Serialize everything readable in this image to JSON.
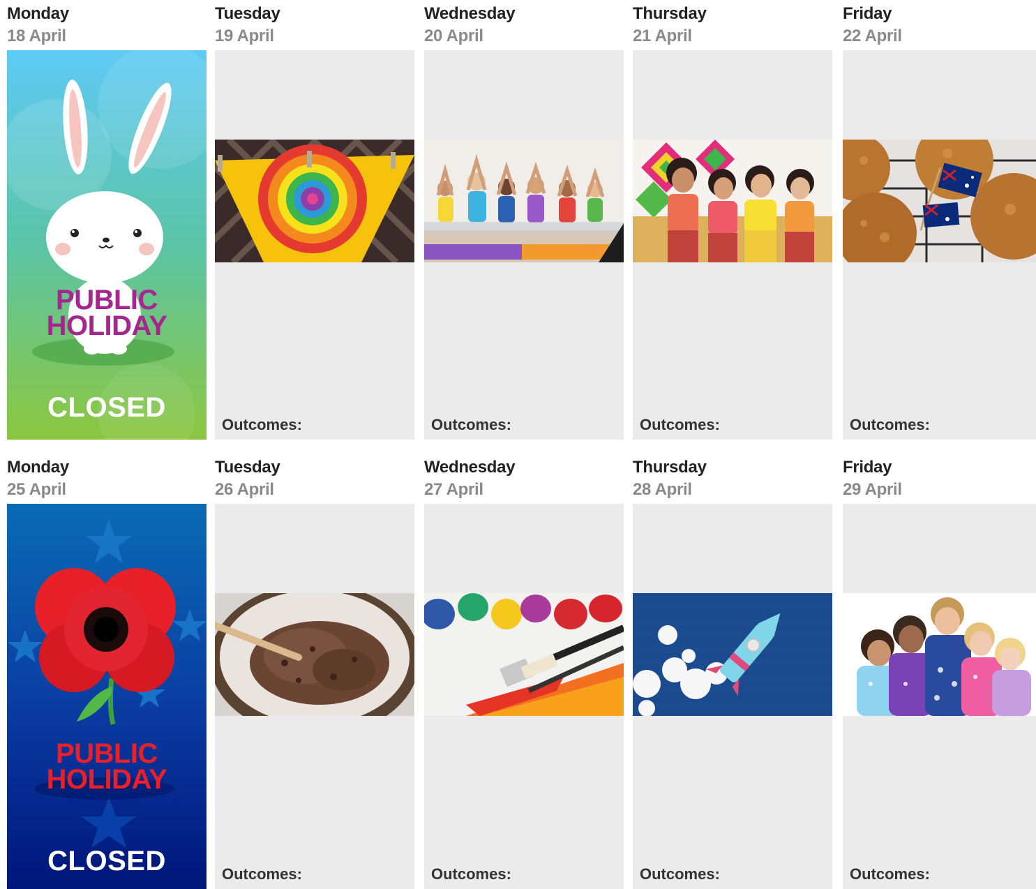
{
  "weeks": [
    {
      "days": [
        {
          "name": "Monday",
          "date": "18 April",
          "holiday": {
            "title_line1": "PUBLIC",
            "title_line2": "HOLIDAY",
            "status": "CLOSED",
            "icon": "bunny-icon"
          }
        },
        {
          "name": "Tuesday",
          "date": "19 April",
          "outcomes": "Outcomes:",
          "photo": "tie-dye-cloth-image"
        },
        {
          "name": "Wednesday",
          "date": "20 April",
          "outcomes": "Outcomes:",
          "photo": "kids-yoga-image"
        },
        {
          "name": "Thursday",
          "date": "21 April",
          "outcomes": "Outcomes:",
          "photo": "kids-festival-image"
        },
        {
          "name": "Friday",
          "date": "22 April",
          "outcomes": "Outcomes:",
          "photo": "anzac-biscuits-image"
        }
      ]
    },
    {
      "days": [
        {
          "name": "Monday",
          "date": "25 April",
          "holiday": {
            "title_line1": "PUBLIC",
            "title_line2": "HOLIDAY",
            "status": "CLOSED",
            "icon": "poppy-icon"
          }
        },
        {
          "name": "Tuesday",
          "date": "26 April",
          "outcomes": "Outcomes:",
          "photo": "chocolate-dough-image"
        },
        {
          "name": "Wednesday",
          "date": "27 April",
          "outcomes": "Outcomes:",
          "photo": "paint-brush-image"
        },
        {
          "name": "Thursday",
          "date": "28 April",
          "outcomes": "Outcomes:",
          "photo": "rocket-craft-image"
        },
        {
          "name": "Friday",
          "date": "29 April",
          "outcomes": "Outcomes:",
          "photo": "kids-pyjamas-image"
        }
      ]
    }
  ],
  "colors": {
    "panel": "#ebebeb",
    "easter_title": "#a3278f",
    "anzac_title": "#e8202a",
    "easter_bg_top": "#5ecaf5",
    "easter_bg_bottom": "#8cc63f",
    "anzac_bg_top": "#0a6bb5",
    "anzac_bg_bottom": "#00157a"
  }
}
